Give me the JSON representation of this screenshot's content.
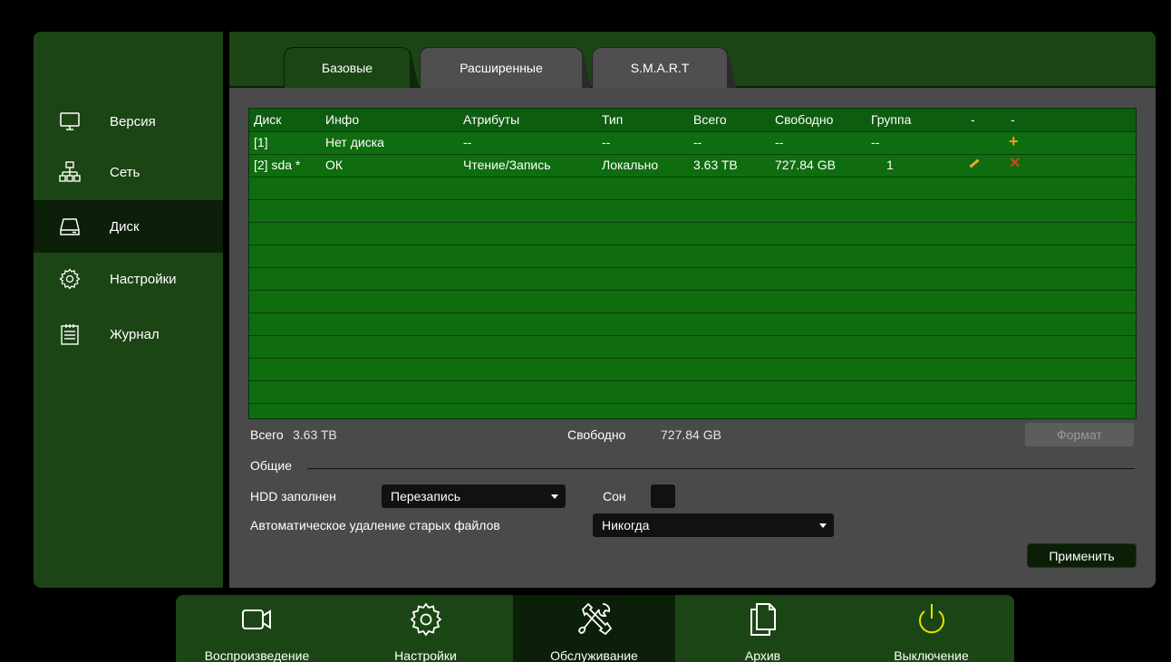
{
  "sidebar": {
    "items": [
      {
        "label": "Версия",
        "icon": "monitor-icon"
      },
      {
        "label": "Сеть",
        "icon": "network-icon"
      },
      {
        "label": "Диск",
        "icon": "hdd-icon",
        "active": true
      },
      {
        "label": "Настройки",
        "icon": "gear-icon"
      },
      {
        "label": "Журнал",
        "icon": "log-icon"
      }
    ]
  },
  "tabs": [
    {
      "label": "Базовые",
      "active": true
    },
    {
      "label": "Расширенные"
    },
    {
      "label": "S.M.A.R.T"
    }
  ],
  "table": {
    "columns": [
      "Диск",
      "Инфо",
      "Атрибуты",
      "Тип",
      "Всего",
      "Свободно",
      "Группа",
      "-",
      "-"
    ],
    "rows": [
      {
        "disk": "[1]",
        "info": "Нет диска",
        "attrs": "--",
        "type": "--",
        "total": "--",
        "free": "--",
        "group": "--"
      },
      {
        "disk": "[2] sda *",
        "info": "ОК",
        "attrs": "Чтение/Запись",
        "type": "Локально",
        "total": "3.63 TB",
        "free": "727.84 GB",
        "group": "1"
      }
    ]
  },
  "summary": {
    "total_label": "Всего",
    "total_value": "3.63 TB",
    "free_label": "Свободно",
    "free_value": "727.84 GB",
    "format_button": "Формат"
  },
  "general": {
    "section_label": "Общие",
    "hdd_full_label": "HDD заполнен",
    "hdd_full_value": "Перезапись",
    "sleep_label": "Сон",
    "autodelete_label": "Автоматическое удаление старых файлов",
    "autodelete_value": "Никогда",
    "apply_button": "Применить"
  },
  "bottom": {
    "items": [
      {
        "label": "Воспроизведение",
        "icon": "camera-icon"
      },
      {
        "label": "Настройки",
        "icon": "gear-icon"
      },
      {
        "label": "Обслуживание",
        "icon": "tools-icon",
        "active": true
      },
      {
        "label": "Архив",
        "icon": "archive-icon"
      },
      {
        "label": "Выключение",
        "icon": "power-icon"
      }
    ]
  },
  "colors": {
    "panel_green": "#1c4515",
    "table_green": "#0f6d10",
    "accent_orange": "#f39c1e",
    "power_yellow": "#e8e000"
  }
}
